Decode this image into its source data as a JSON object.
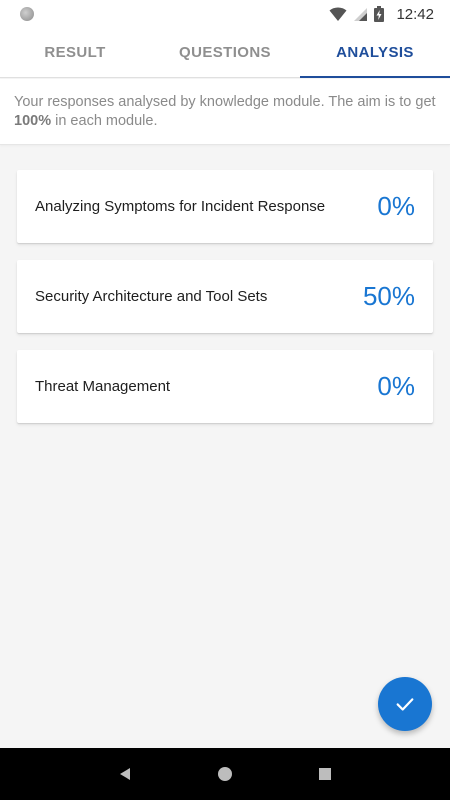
{
  "status_bar": {
    "time": "12:42"
  },
  "tabs": [
    {
      "label": "RESULT",
      "active": false
    },
    {
      "label": "QUESTIONS",
      "active": false
    },
    {
      "label": "ANALYSIS",
      "active": true
    }
  ],
  "intro": {
    "text_before": "Your responses analysed by knowledge module. The aim is to get ",
    "highlight": "100%",
    "text_after": " in each module."
  },
  "modules": [
    {
      "name": "Analyzing Symptoms for Incident Response",
      "score": "0%"
    },
    {
      "name": "Security Architecture and Tool Sets",
      "score": "50%"
    },
    {
      "name": "Threat Management",
      "score": "0%"
    }
  ],
  "fab": {
    "icon": "check-icon"
  },
  "nav": {
    "icons": [
      "back-icon",
      "home-icon",
      "recents-icon"
    ]
  },
  "colors": {
    "accent": "#1976d2",
    "tab_active": "#1f4e9b",
    "tab_inactive": "#8f8f8f",
    "background": "#f5f5f5"
  }
}
